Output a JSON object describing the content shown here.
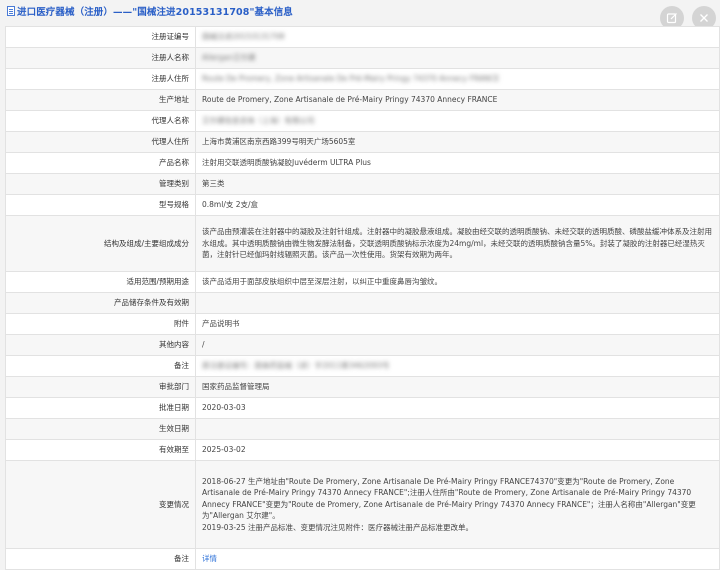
{
  "header": {
    "title": "进口医疗器械（注册）——\"国械注进20153131708\"基本信息",
    "edit_icon": "edit-icon",
    "close_icon": "close-icon"
  },
  "rows": [
    {
      "label": "注册证编号",
      "value": "国械注进20153131708",
      "blurred": true,
      "h": 21
    },
    {
      "label": "注册人名称",
      "value": "Allergan艾尔建",
      "blurred": true,
      "h": 21
    },
    {
      "label": "注册人住所",
      "value": "Route De Promery, Zone Artisanale De Pré-Mairy Pringy 74370 Annecy FRANCE",
      "blurred": true,
      "h": 21
    },
    {
      "label": "生产地址",
      "value": "Route de Promery, Zone Artisanale de Pré-Mairy Pringy 74370 Annecy FRANCE",
      "blurred": false,
      "h": 21
    },
    {
      "label": "代理人名称",
      "value": "艾尔建信息咨询（上海）有限公司",
      "blurred": true,
      "h": 21
    },
    {
      "label": "代理人住所",
      "value": "上海市黄浦区南京西路399号明天广场5605室",
      "blurred": false,
      "h": 21
    },
    {
      "label": "产品名称",
      "value": "注射用交联透明质酸钠凝胶Juvéderm ULTRA Plus",
      "blurred": false,
      "h": 21
    },
    {
      "label": "管理类别",
      "value": "第三类",
      "blurred": false,
      "h": 21
    },
    {
      "label": "型号规格",
      "value": "0.8ml/支 2支/盒",
      "blurred": false,
      "h": 21
    },
    {
      "label": "结构及组成/主要组成成分",
      "value": "该产品由预灌装在注射器中的凝胶及注射针组成。注射器中的凝胶悬液组成。凝胶由经交联的透明质酸钠、未经交联的透明质酸、磷酸盐缓冲体系及注射用水组成。其中透明质酸钠由微生物发酵法制备，交联透明质酸钠标示浓度为24mg/ml，未经交联的透明质酸钠含量5%。封装了凝胶的注射器已经湿热灭菌，注射针已经伽玛射线辐照灭菌。该产品一次性使用。货架有效期为两年。",
      "blurred": false,
      "h": 56
    },
    {
      "label": "适用范围/预期用途",
      "value": "该产品适用于面部皮肤组织中层至深层注射，以纠正中重度鼻唇沟皱纹。",
      "blurred": false,
      "h": 21
    },
    {
      "label": "产品储存条件及有效期",
      "value": "",
      "blurred": false,
      "h": 21
    },
    {
      "label": "附件",
      "value": "产品说明书",
      "blurred": false,
      "h": 21
    },
    {
      "label": "其他内容",
      "value": "/",
      "blurred": false,
      "h": 21
    },
    {
      "label": "备注",
      "value": "原注册证编号：国食药监械（进）字2011第3462093号",
      "blurred": true,
      "h": 21
    },
    {
      "label": "审批部门",
      "value": "国家药品监督管理局",
      "blurred": false,
      "h": 21
    },
    {
      "label": "批准日期",
      "value": "2020-03-03",
      "blurred": false,
      "h": 21
    },
    {
      "label": "生效日期",
      "value": "",
      "blurred": false,
      "h": 21
    },
    {
      "label": "有效期至",
      "value": "2025-03-02",
      "blurred": false,
      "h": 21
    },
    {
      "label": "变更情况",
      "value": "2018-06-27 生产地址由\"Route De Promery, Zone Artisanale De Pré-Mairy Pringy FRANCE74370\"变更为\"Route de Promery, Zone Artisanale de Pré-Mairy Pringy 74370 Annecy FRANCE\";注册人住所由\"Route de Promery, Zone Artisanale de Pré-Mairy Pringy 74370 Annecy FRANCE\"变更为\"Route de Promery, Zone Artisanale de Pré-Mairy Pringy 74370 Annecy FRANCE\"；注册人名称由\"Allergan\"变更为\"Allergan 艾尔建\"。\n2019-03-25 注册产品标准、变更情况注见附件：医疗器械注册产品标准更改单。",
      "blurred": false,
      "h": 88
    },
    {
      "label": "备注",
      "value": "详情",
      "blurred": false,
      "link": true,
      "h": 21
    }
  ]
}
